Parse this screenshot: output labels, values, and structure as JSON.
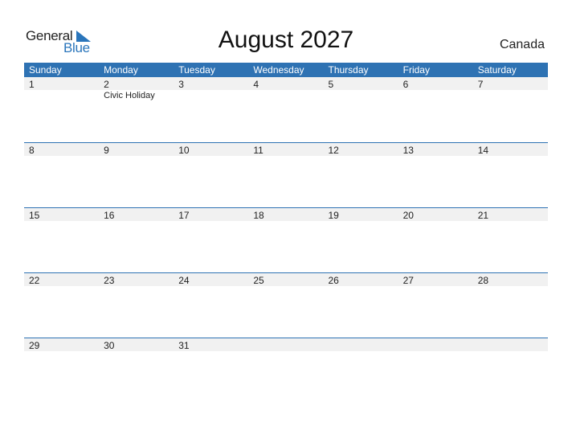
{
  "logo": {
    "part1": "General",
    "part2": "Blue"
  },
  "title": "August 2027",
  "country": "Canada",
  "colors": {
    "header_bg": "#2e72b3",
    "strip_bg": "#f1f1f1",
    "brand_blue": "#2a75bb"
  },
  "weekdays": [
    "Sunday",
    "Monday",
    "Tuesday",
    "Wednesday",
    "Thursday",
    "Friday",
    "Saturday"
  ],
  "weeks": [
    {
      "days": [
        "1",
        "2",
        "3",
        "4",
        "5",
        "6",
        "7"
      ],
      "events": [
        "",
        "Civic Holiday",
        "",
        "",
        "",
        "",
        ""
      ]
    },
    {
      "days": [
        "8",
        "9",
        "10",
        "11",
        "12",
        "13",
        "14"
      ],
      "events": [
        "",
        "",
        "",
        "",
        "",
        "",
        ""
      ]
    },
    {
      "days": [
        "15",
        "16",
        "17",
        "18",
        "19",
        "20",
        "21"
      ],
      "events": [
        "",
        "",
        "",
        "",
        "",
        "",
        ""
      ]
    },
    {
      "days": [
        "22",
        "23",
        "24",
        "25",
        "26",
        "27",
        "28"
      ],
      "events": [
        "",
        "",
        "",
        "",
        "",
        "",
        ""
      ]
    },
    {
      "days": [
        "29",
        "30",
        "31",
        "",
        "",
        "",
        ""
      ],
      "events": [
        "",
        "",
        "",
        "",
        "",
        "",
        ""
      ]
    }
  ]
}
